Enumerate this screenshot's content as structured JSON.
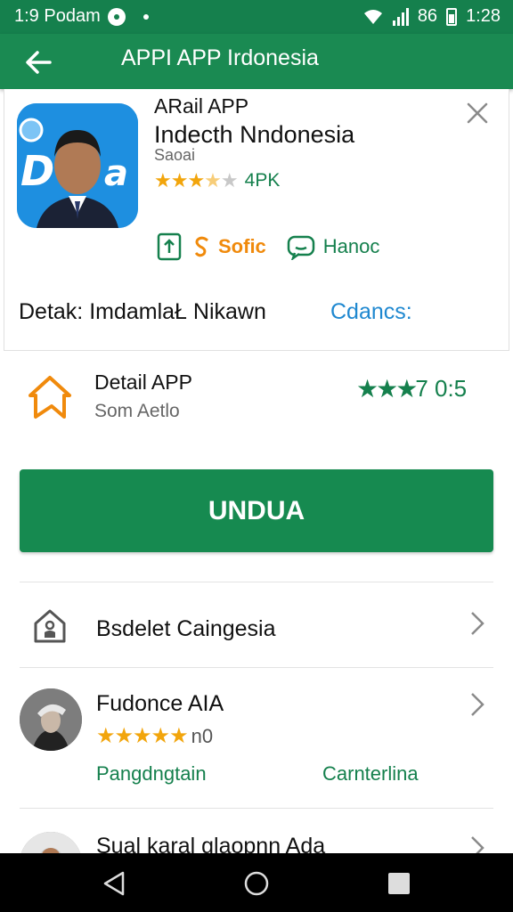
{
  "status_bar": {
    "time_left": "1:9 Podam",
    "signal_text": "86",
    "time_right": "1:28"
  },
  "app_bar": {
    "title": "APPI APP Irdonesia",
    "back_icon": "arrow-left-icon"
  },
  "card": {
    "title": "ARail APP",
    "subtitle": "Indecth Nndonesia",
    "developer": "Saoai",
    "rating_stars": 3.5,
    "rating_label": "4PK",
    "actions": {
      "share_icon": "share-icon",
      "orange_label": "Sofic",
      "chat_label": "Hanoc"
    },
    "detail_text": "Detak:  ImdamlaŁ Nikawn",
    "detail_link": "Cdancs:"
  },
  "detail": {
    "title": "Detail APP",
    "subtitle": "Som Aetlo",
    "rating_value": "7 0:5"
  },
  "download_button": "UNDUA",
  "list": {
    "item1_label": "Bsdelet Caingesia",
    "review": {
      "name": "Fudonce AIA",
      "stars": 5,
      "count": "n0",
      "link_left": "Pangdngtain",
      "link_right": "Carnterlina"
    },
    "item3_label": "Sual karal glaopnn Ada"
  },
  "colors": {
    "primary_green": "#15804d",
    "star_orange": "#f2a50c",
    "link_blue": "#1f88d0"
  }
}
